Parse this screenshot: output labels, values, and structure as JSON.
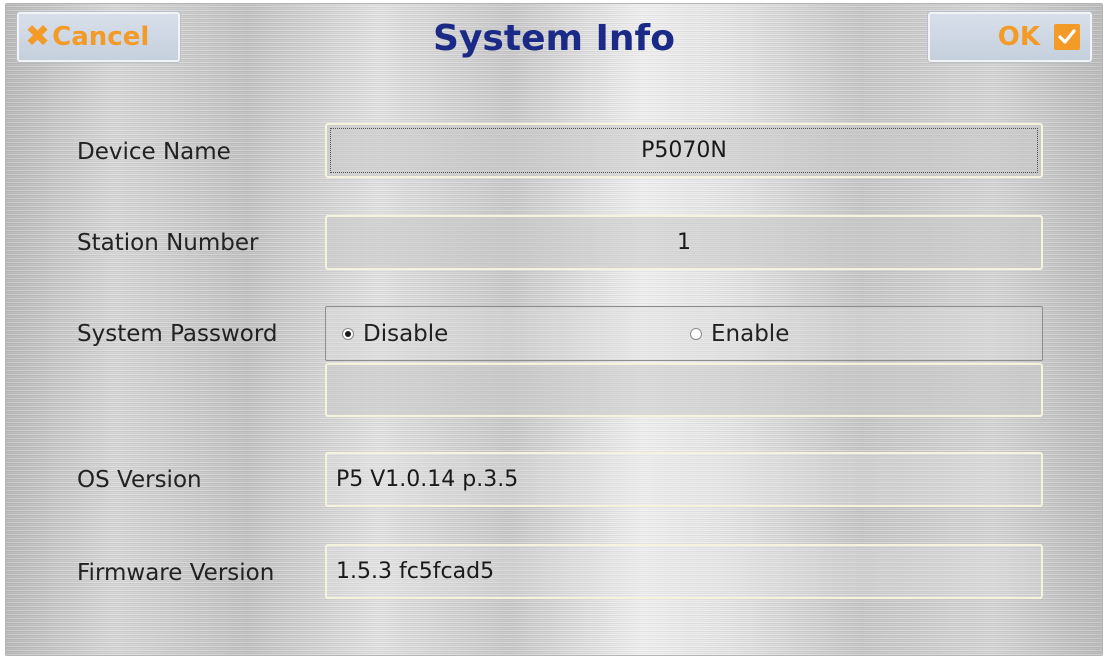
{
  "header": {
    "cancel_label": "Cancel",
    "title": "System Info",
    "ok_label": "OK"
  },
  "device_name": {
    "label": "Device Name",
    "value": "P5070N"
  },
  "station_number": {
    "label": "Station Number",
    "value": "1"
  },
  "system_password": {
    "label": "System Password",
    "options": [
      "Disable",
      "Enable"
    ],
    "selected": "Disable",
    "password_value": ""
  },
  "os_version": {
    "label": "OS Version",
    "value": "P5 V1.0.14 p.3.5"
  },
  "firmware_version": {
    "label": "Firmware Version",
    "value": "1.5.3 fc5fcad5"
  },
  "colors": {
    "accent": "#f39a27",
    "title": "#1b2a86"
  },
  "icons": {
    "cancel": "close-x-icon",
    "ok": "checkbox-check-icon"
  }
}
